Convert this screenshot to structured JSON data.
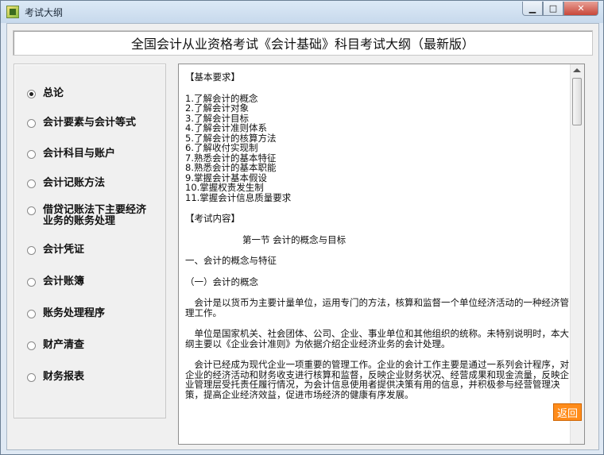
{
  "window": {
    "title": "考试大纲"
  },
  "header": {
    "title": "全国会计从业资格考试《会计基础》科目考试大纲（最新版）"
  },
  "sidebar": {
    "items": [
      {
        "label": "总论",
        "selected": true
      },
      {
        "label": "会计要素与会计等式",
        "selected": false
      },
      {
        "label": "会计科目与账户",
        "selected": false
      },
      {
        "label": "会计记账方法",
        "selected": false
      },
      {
        "label": "借贷记账法下主要经济业务的账务处理",
        "selected": false
      },
      {
        "label": "会计凭证",
        "selected": false
      },
      {
        "label": "会计账簿",
        "selected": false
      },
      {
        "label": "账务处理程序",
        "selected": false
      },
      {
        "label": "财产清查",
        "selected": false
      },
      {
        "label": "财务报表",
        "selected": false
      }
    ]
  },
  "content": {
    "req_heading": "【基本要求】",
    "requirements": [
      "1.了解会计的概念",
      "2.了解会计对象",
      "3.了解会计目标",
      "4.了解会计准则体系",
      "5.了解会计的核算方法",
      "6.了解收付实现制",
      "7.熟悉会计的基本特征",
      "8.熟悉会计的基本职能",
      "9.掌握会计基本假设",
      "10.掌握权责发生制",
      "11.掌握会计信息质量要求"
    ],
    "exam_heading": "【考试内容】",
    "section_title": "第一节 会计的概念与目标",
    "sub1": "一、会计的概念与特征",
    "sub2": "（一）会计的概念",
    "para1": "会计是以货币为主要计量单位，运用专门的方法，核算和监督一个单位经济活动的一种经济管理工作。",
    "para2": "单位是国家机关、社会团体、公司、企业、事业单位和其他组织的统称。未特别说明时，本大纲主要以《企业会计准则》为依据介绍企业经济业务的会计处理。",
    "para3": "会计已经成为现代企业一项重要的管理工作。企业的会计工作主要是通过一系列会计程序，对企业的经济活动和财务收支进行核算和监督，反映企业财务状况、经营成果和现金流量，反映企业管理层受托责任履行情况，为会计信息使用者提供决策有用的信息，并积极参与经营管理决策，提高企业经济效益，促进市场经济的健康有序发展。"
  },
  "back_button": "返回",
  "icons": {
    "app": "exam-app-icon",
    "minimize": "minimize-icon",
    "maximize": "maximize-icon",
    "close": "close-icon"
  }
}
